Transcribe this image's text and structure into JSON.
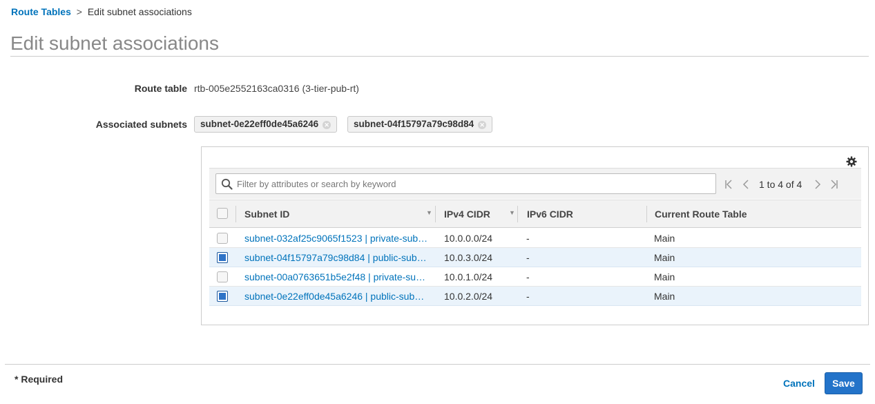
{
  "breadcrumb": {
    "parent": "Route Tables",
    "separator": ">",
    "current": "Edit subnet associations"
  },
  "page_title": "Edit subnet associations",
  "route_table": {
    "label": "Route table",
    "value": "rtb-005e2552163ca0316 (3-tier-pub-rt)"
  },
  "associated_subnets": {
    "label": "Associated subnets",
    "chips": [
      "subnet-0e22eff0de45a6246",
      "subnet-04f15797a79c98d84"
    ]
  },
  "table": {
    "search_placeholder": "Filter by attributes or search by keyword",
    "pagination": "1 to 4 of 4",
    "columns": [
      "Subnet ID",
      "IPv4 CIDR",
      "IPv6 CIDR",
      "Current Route Table"
    ],
    "rows": [
      {
        "subnet": "subnet-032af25c9065f1523 | private-sub…",
        "ipv4": "10.0.0.0/24",
        "ipv6": "-",
        "route_table": "Main",
        "selected": false
      },
      {
        "subnet": "subnet-04f15797a79c98d84 | public-sub…",
        "ipv4": "10.0.3.0/24",
        "ipv6": "-",
        "route_table": "Main",
        "selected": true
      },
      {
        "subnet": "subnet-00a0763651b5e2f48 | private-su…",
        "ipv4": "10.0.1.0/24",
        "ipv6": "-",
        "route_table": "Main",
        "selected": false
      },
      {
        "subnet": "subnet-0e22eff0de45a6246 | public-sub…",
        "ipv4": "10.0.2.0/24",
        "ipv6": "-",
        "route_table": "Main",
        "selected": true
      }
    ]
  },
  "footer": {
    "required_note": "* Required",
    "cancel_label": "Cancel",
    "save_label": "Save"
  },
  "colors": {
    "link": "#0073bb",
    "primary_button": "#2373c9",
    "selected_row": "#eaf3fb"
  },
  "icons": [
    "search-icon",
    "gear-icon",
    "first-page-icon",
    "prev-page-icon",
    "next-page-icon",
    "last-page-icon",
    "remove-chip-icon",
    "sort-caret-icon"
  ]
}
